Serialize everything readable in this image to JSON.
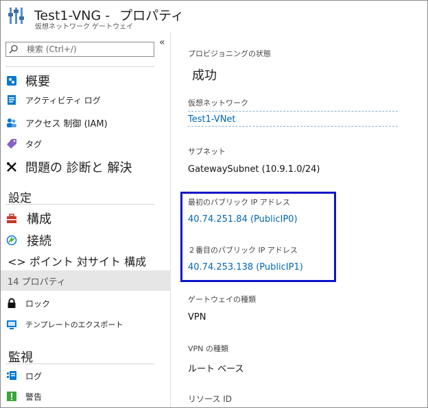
{
  "header": {
    "title_resource": "Test1-VNG -",
    "title_section": "プロパティ",
    "subtitle": "仮想ネットワーク ゲートウェイ"
  },
  "sidebar": {
    "collapse_label": "«",
    "search_placeholder": "検索 (Ctrl+/)",
    "items": [
      {
        "label": "概要",
        "icon": "overview-icon",
        "color": "#0078d4"
      },
      {
        "label": "アクティビティ ログ",
        "icon": "activity-log-icon",
        "color": "#0078d4"
      },
      {
        "label": "アクセス 制御 (IAM)",
        "icon": "iam-icon",
        "color": "#0078d4"
      },
      {
        "label": "タグ",
        "icon": "tag-icon",
        "color": "#8661c5"
      },
      {
        "label": "問題の 診断と 解決",
        "icon": "wrench-icon",
        "color": "#222222"
      }
    ],
    "settings_header": "設定",
    "settings_items": [
      {
        "label": "構成",
        "icon": "toolbox-icon",
        "color": "#c0392b"
      },
      {
        "label": "接続",
        "icon": "connection-icon",
        "color": "#0078d4"
      },
      {
        "label": "<> ポイント 対サイト 構成",
        "icon": "",
        "color": ""
      },
      {
        "label": "14 プロパティ",
        "icon": "",
        "color": ""
      },
      {
        "label": "ロック",
        "icon": "lock-icon",
        "color": "#111111"
      },
      {
        "label": "テンプレートのエクスポート",
        "icon": "export-template-icon",
        "color": "#0078d4"
      }
    ],
    "monitoring_header": "監視",
    "monitoring_items": [
      {
        "label": "ログ",
        "icon": "logs-icon",
        "color": "#0078d4"
      },
      {
        "label": "警告",
        "icon": "alert-icon",
        "color": "#3aa53a"
      }
    ]
  },
  "properties": {
    "provisioning_state_label": "プロビジョニングの状態",
    "provisioning_state_value": "成功",
    "vnet_label": "仮想ネットワーク",
    "vnet_value": "Test1-VNet",
    "subnet_label": "サブネット",
    "subnet_value": "GatewaySubnet (10.9.1.0/24)",
    "public_ip1_label": "最初のパブリック IP アドレス",
    "public_ip1_value": "40.74.251.84 (PublicIP0)",
    "public_ip2_label": "２番目のパブリック IP アドレス",
    "public_ip2_value": "40.74.253.138 (PublicIP1)",
    "gateway_type_label": "ゲートウェイの種類",
    "gateway_type_value": "VPN",
    "vpn_type_label": "VPN の種類",
    "vpn_type_value": "ルート ベース",
    "resource_id_label": "リソース ID"
  },
  "colors": {
    "link": "#0066b8",
    "highlight_border": "#0a14c8",
    "active_row": "#e6e6e6"
  }
}
